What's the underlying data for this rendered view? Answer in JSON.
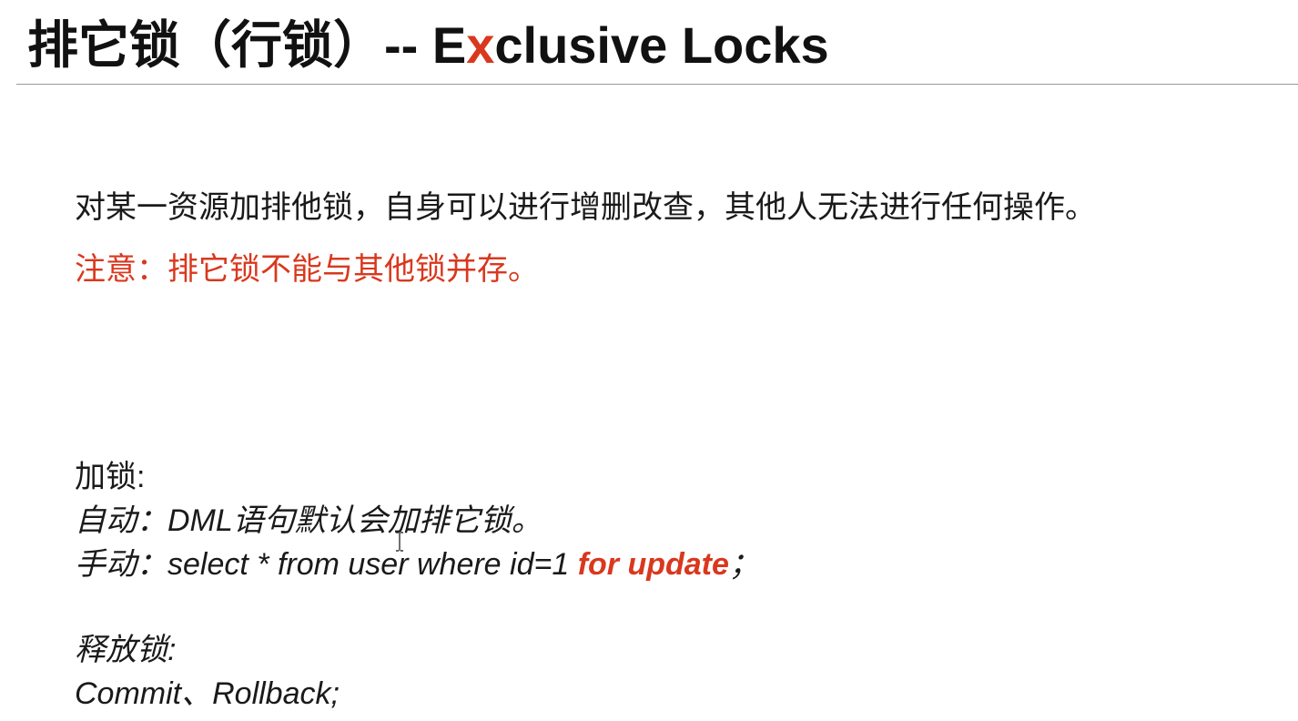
{
  "title": {
    "cn": "排它锁（行锁）-- E",
    "accent": "x",
    "rest": "clusive Locks"
  },
  "description": "对某一资源加排他锁，自身可以进行增删改查，其他人无法进行任何操作。",
  "note": "注意：排它锁不能与其他锁并存。",
  "lock": {
    "heading": "加锁:",
    "auto": "自动：DML语句默认会加排它锁。",
    "manual_prefix": "手动：select * from user where id=1 ",
    "manual_keyword": "for update",
    "manual_suffix": "；"
  },
  "release": {
    "heading": "释放锁:",
    "text": "Commit、Rollback;"
  },
  "colors": {
    "accent": "#d9381e",
    "text": "#1a1a1a"
  }
}
